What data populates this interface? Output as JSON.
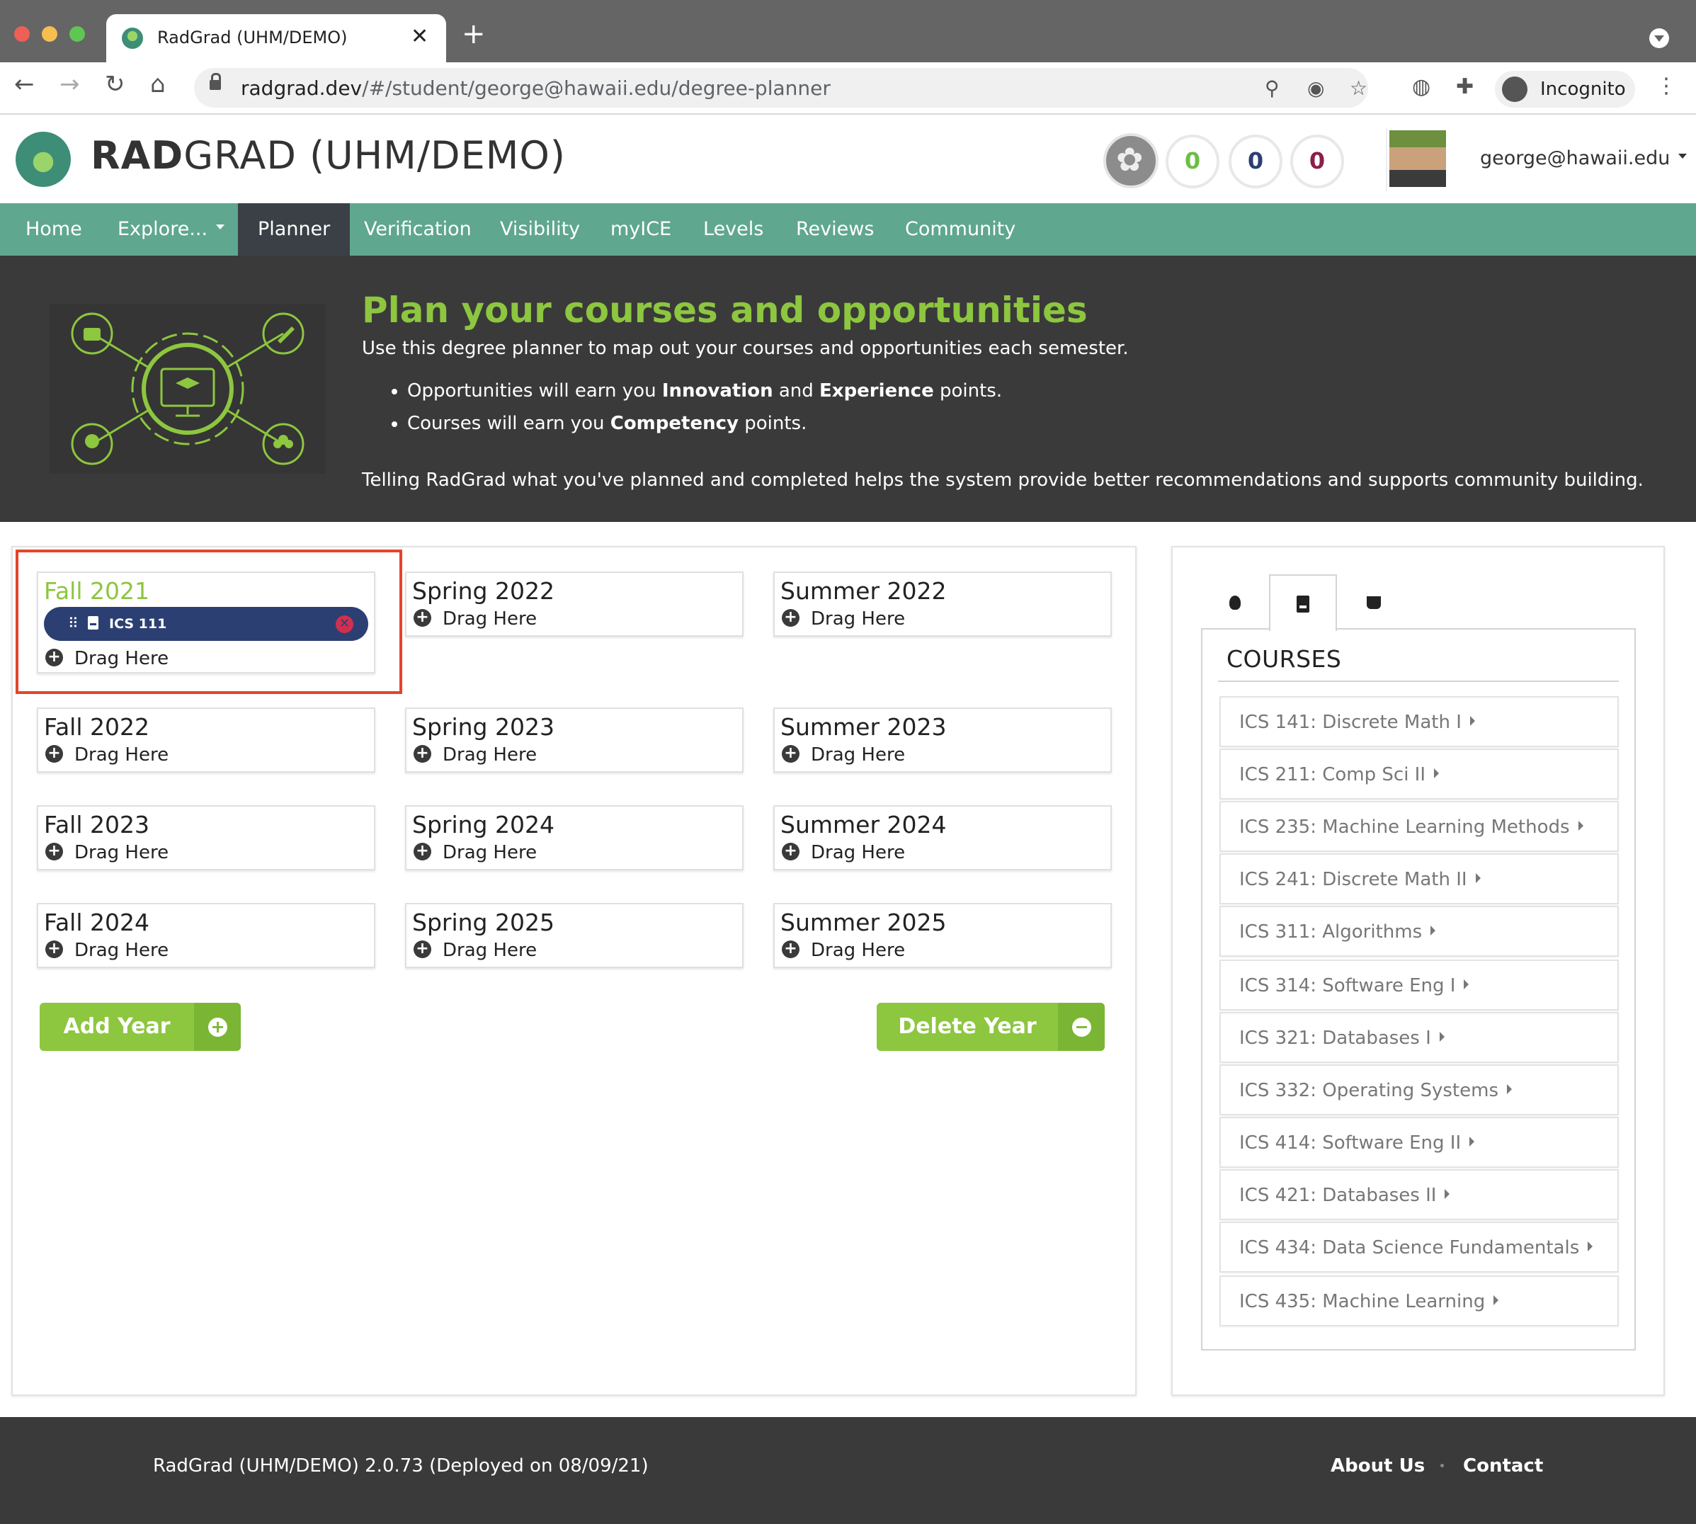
{
  "browser": {
    "tab_title": "RadGrad (UHM/DEMO)",
    "url_host": "radgrad.dev",
    "url_path": "/#/student/george@hawaii.edu/degree-planner",
    "incognito_label": "Incognito",
    "traffic_colors": [
      "#ee5f57",
      "#f5be4f",
      "#5fc553"
    ]
  },
  "header": {
    "brand_bold": "RAD",
    "brand_rest": "GRAD (UHM/DEMO)",
    "ice": [
      {
        "value": "0",
        "color": "#6cbf45"
      },
      {
        "value": "0",
        "color": "#2c3f73"
      },
      {
        "value": "0",
        "color": "#8b1e4a"
      }
    ],
    "user_email": "george@hawaii.edu"
  },
  "nav": {
    "items": [
      {
        "label": "Home"
      },
      {
        "label": "Explore..."
      },
      {
        "label": "Planner",
        "active": true
      },
      {
        "label": "Verification"
      },
      {
        "label": "Visibility"
      },
      {
        "label": "myICE"
      },
      {
        "label": "Levels"
      },
      {
        "label": "Reviews"
      },
      {
        "label": "Community"
      }
    ]
  },
  "hero": {
    "title": "Plan your courses and opportunities",
    "intro": "Use this degree planner to map out your courses and opportunities each semester.",
    "bullet1": {
      "a": "Opportunities will earn you ",
      "b1": "Innovation",
      "c": " and ",
      "b2": "Experience",
      "d": " points."
    },
    "bullet2": {
      "a": "Courses will earn you ",
      "b1": "Competency",
      "c": " points."
    },
    "footer": "Telling RadGrad what you've planned and completed helps the system provide better recommendations and supports community building."
  },
  "planner": {
    "drag_label": "Drag Here",
    "semesters": [
      {
        "name": "Fall 2021",
        "current": true,
        "courses": [
          "ICS 111"
        ]
      },
      {
        "name": "Spring 2022"
      },
      {
        "name": "Summer 2022"
      },
      {
        "name": "Fall 2022"
      },
      {
        "name": "Spring 2023"
      },
      {
        "name": "Summer 2023"
      },
      {
        "name": "Fall 2023"
      },
      {
        "name": "Spring 2024"
      },
      {
        "name": "Summer 2024"
      },
      {
        "name": "Fall 2024"
      },
      {
        "name": "Spring 2025"
      },
      {
        "name": "Summer 2025"
      }
    ],
    "add_year_label": "Add Year",
    "delete_year_label": "Delete Year"
  },
  "sidebar": {
    "active_tab": "courses",
    "header": "COURSES",
    "courses": [
      "ICS 141: Discrete Math I",
      "ICS 211: Comp Sci II",
      "ICS 235: Machine Learning Methods",
      "ICS 241: Discrete Math II",
      "ICS 311: Algorithms",
      "ICS 314: Software Eng I",
      "ICS 321: Databases I",
      "ICS 332: Operating Systems",
      "ICS 414: Software Eng II",
      "ICS 421: Databases II",
      "ICS 434: Data Science Fundamentals",
      "ICS 435: Machine Learning"
    ]
  },
  "footer": {
    "version": "RadGrad (UHM/DEMO) 2.0.73 (Deployed on 08/09/21)",
    "about": "About Us",
    "contact": "Contact"
  }
}
